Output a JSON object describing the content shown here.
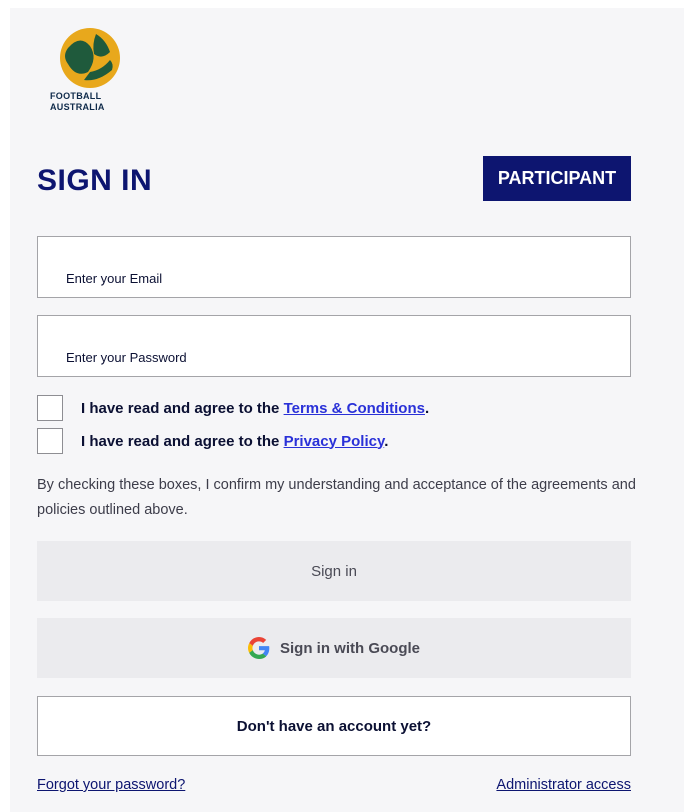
{
  "brand": {
    "logo_text_line1": "FOOTBALL",
    "logo_text_line2": "AUSTRALIA",
    "colors": {
      "navy": "#0d1570",
      "gold": "#e8a81c",
      "green": "#1f5a3c",
      "link": "#2a31d8"
    }
  },
  "header": {
    "title": "SIGN IN",
    "badge": "PARTICIPANT"
  },
  "form": {
    "email_placeholder": "Enter your Email",
    "password_placeholder": "Enter your Password",
    "terms_prefix": "I have read and agree to the ",
    "terms_link": "Terms & Conditions",
    "terms_suffix": ".",
    "privacy_prefix": "I have read and agree to the ",
    "privacy_link": "Privacy Policy",
    "privacy_suffix": ".",
    "note": "By checking these boxes, I confirm my understanding and acceptance of the agreements and policies outlined above."
  },
  "buttons": {
    "sign_in": "Sign in",
    "google": "Sign in with Google",
    "no_account": "Don't have an account yet?"
  },
  "footer": {
    "forgot": "Forgot your password?",
    "admin": "Administrator access"
  },
  "icons": [
    "football-australia-logo-icon",
    "google-icon"
  ]
}
